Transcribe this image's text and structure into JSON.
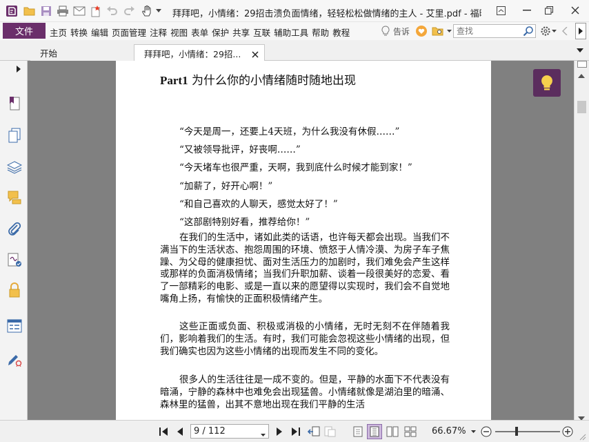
{
  "app": {
    "window_title": "拜拜吧，小情绪：29招击溃负面情绪，轻轻松松做情绪的主人 - 艾里.pdf - 福昕高...",
    "colors": {
      "brand": "#6b2f6b",
      "accent_dark": "#5b2d5e",
      "viewer_bg": "#808080"
    }
  },
  "titlebar": {
    "logo_icon": "foxit-logo-icon",
    "quick_access": [
      "open-folder-icon",
      "save-icon",
      "print-icon",
      "email-icon",
      "new-star-icon",
      "undo-icon",
      "redo-icon",
      "hand-tool-icon"
    ]
  },
  "menu": {
    "file_label": "文件",
    "items": [
      "主页",
      "转换",
      "编辑",
      "页面管理",
      "注释",
      "视图",
      "表单",
      "保护",
      "共享",
      "互联",
      "辅助工具",
      "帮助",
      "教程"
    ],
    "tell_me": "告诉",
    "search_placeholder": "查找"
  },
  "tabs": [
    {
      "label": "开始",
      "active": false
    },
    {
      "label": "拜拜吧，小情绪：29招...",
      "active": true
    }
  ],
  "sidebar": {
    "icons": [
      "bookmark-icon",
      "pages-icon",
      "layers-icon",
      "comments-icon",
      "attachments-icon",
      "signature-icon",
      "security-lock-icon",
      "form-fields-icon",
      "sign-pen-icon"
    ]
  },
  "document": {
    "heading_en": "Part1",
    "heading_cn": " 为什么你的小情绪随时随地出现",
    "quotes": [
      "“今天是周一，还要上4天班，为什么我没有休假……”",
      "“又被领导批评，好丧啊……”",
      "“今天堵车也很严重，天啊，我到底什么时候才能到家！”",
      "“加薪了，好开心啊！”",
      "“和自己喜欢的人聊天，感觉太好了！”",
      "“这部剧特别好看，推荐给你！”"
    ],
    "paragraphs": [
      "在我们的生活中，诸如此类的话语，也许每天都会出现。当我们不满当下的生活状态、抱怨周围的环境、愤怒于人情冷漠、为房子车子焦躁、为父母的健康担忧、面对生活压力的加剧时，我们难免会产生这样或那样的负面消极情绪；当我们升职加薪、谈着一段很美好的恋爱、看了一部精彩的电影、或是一直以来的愿望得以实现时，我们会不自觉地嘴角上扬，有愉快的正面积极情绪产生。",
      "这些正面或负面、积极或消极的小情绪，无时无刻不在伴随着我们，影响着我们的生活。有时，我们可能会忽视这些小情绪的出现，但我们确实也因为这些小情绪的出现而发生不同的变化。",
      "很多人的生活往往是一成不变的。但是，平静的水面下不代表没有暗涌，宁静的森林中也难免会出现猛兽。小情绪就像是湖泊里的暗涌、森林里的猛兽，出其不意地出现在我们平静的生活"
    ]
  },
  "status": {
    "page_display": "9 / 112",
    "zoom": "66.67%",
    "zoom_level": 0.33
  }
}
